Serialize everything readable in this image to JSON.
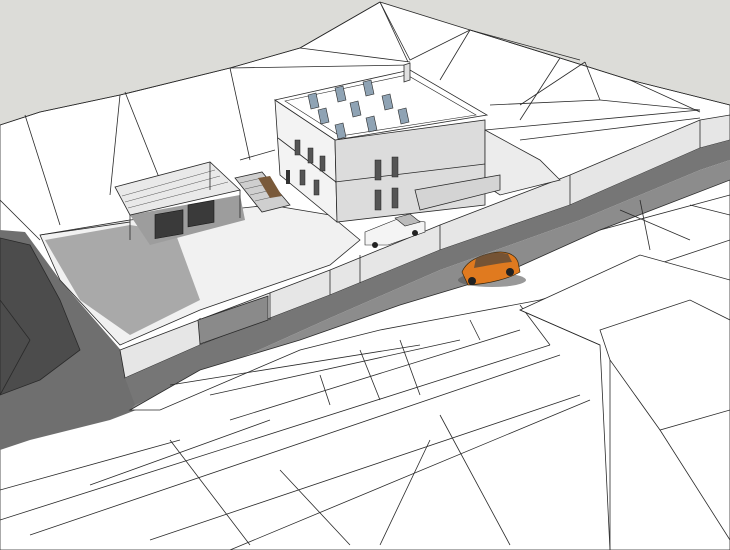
{
  "colors": {
    "background": "#dcdcd8",
    "terrain": "#ffffff",
    "shadow": "#6f6f6f",
    "wall": "#e6e6e6",
    "wall_dark": "#bdbdbd",
    "car": "#e07a1f",
    "solar_panel": "#8fa3b4"
  }
}
